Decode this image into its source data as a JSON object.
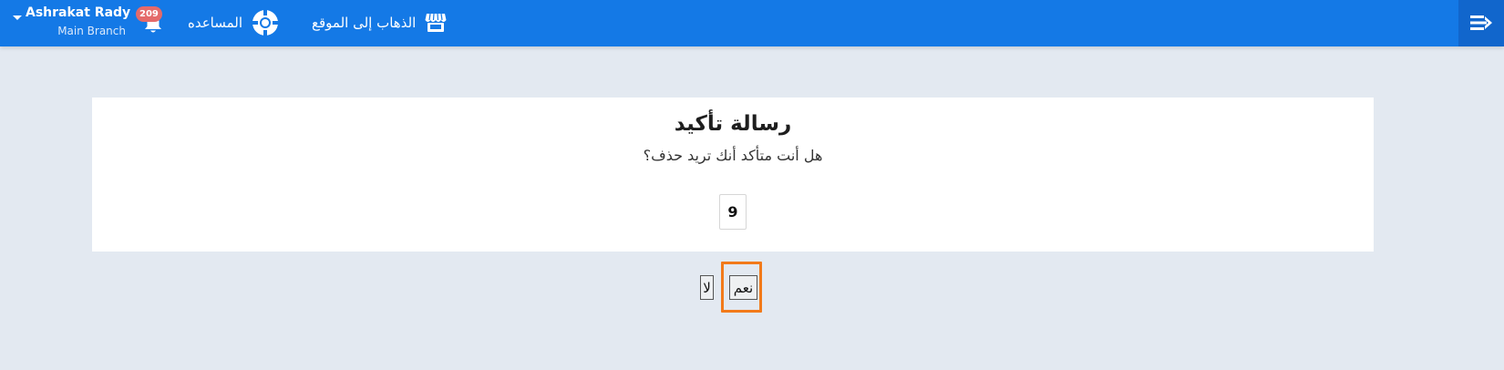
{
  "header": {
    "user_name": "Ashrakat Rady",
    "branch": "Main Branch",
    "notifications_count": "209",
    "help_label": "المساعده",
    "go_to_site_label": "الذهاب إلى الموقع",
    "colors": {
      "bar": "#1479e6",
      "badge": "#e46a6a"
    },
    "icons": [
      "caret-down-icon",
      "bell-icon",
      "lifebuoy-icon",
      "store-icon",
      "menu-toggle-icon"
    ]
  },
  "dialog": {
    "title": "رسالة تأكيد",
    "message": "هل أنت متأكد أنك تريد حذف؟",
    "item_id": "9"
  },
  "actions": {
    "yes_label": "نعم",
    "no_label": "لا",
    "focus_color": "#f27a1a"
  }
}
